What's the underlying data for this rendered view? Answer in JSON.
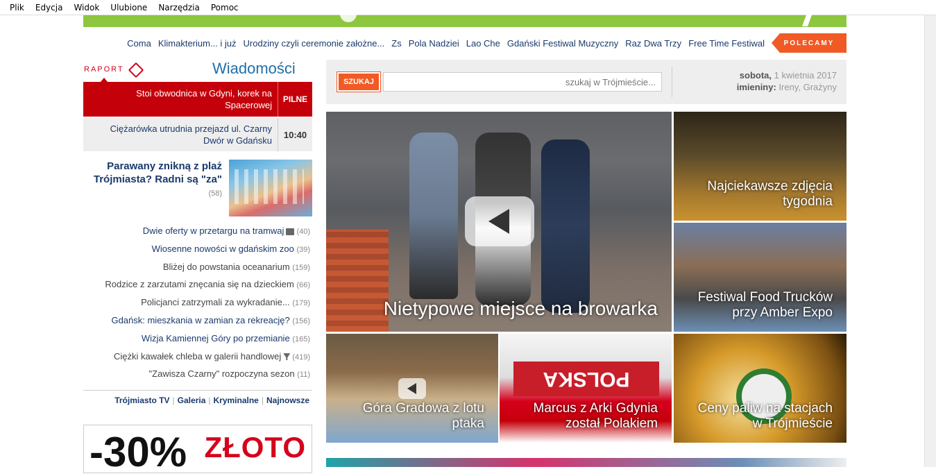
{
  "menu": [
    "Plik",
    "Edycja",
    "Widok",
    "Ulubione",
    "Narzędzia",
    "Pomoc"
  ],
  "recommend": {
    "badge": "POLECAMY",
    "links": [
      "Free Time Festiwal",
      "Raz Dwa Trzy",
      "Gdański Festiwal Muzyczny",
      "Lao Che",
      "Pola Nadziei",
      "Zs",
      "Urodziny czyli ceremonie założne...",
      "Klimakterium... i już",
      "Coma"
    ]
  },
  "news": {
    "title": "Wiadomości",
    "raport": "RAPORT",
    "urgent": {
      "label": "PILNE",
      "text": "Stoi obwodnica w Gdyni, korek na Spacerowej"
    },
    "latest": {
      "time": "10:40",
      "text": "Ciężarówka utrudnia przejazd ul. Czarny Dwór w Gdańsku"
    },
    "feature": {
      "title": "Parawany znikną z plaż Trójmiasta? Radni są \"za\"",
      "count": "(58)"
    },
    "items": [
      {
        "text": "Dwie oferty w przetargu na tramwaj",
        "count": "(40)",
        "icon": "video"
      },
      {
        "text": "Wiosenne nowości w gdańskim zoo",
        "count": "(39)"
      },
      {
        "text": "Bliżej do powstania oceanarium",
        "count": "(159)"
      },
      {
        "text": "Rodzice z zarzutami znęcania się na dzieckiem",
        "count": "(66)"
      },
      {
        "text": "Policjanci zatrzymali za wykradanie...",
        "count": "(179)"
      },
      {
        "text": "Gdańsk: mieszkania w zamian za rekreację?",
        "count": "(156)"
      },
      {
        "text": "Wizja Kamiennej Góry po przemianie",
        "count": "(165)"
      },
      {
        "text": "Ciężki kawałek chleba w galerii handlowej",
        "count": "(419)",
        "icon": "filter"
      },
      {
        "text": "\"Zawisza Czarny\" rozpoczyna sezon",
        "count": "(11)"
      }
    ],
    "bottom_links": [
      "Najnowsze",
      "Kryminalne",
      "Galeria",
      "Trójmiasto TV"
    ]
  },
  "ad": {
    "brand": "ZŁOTO",
    "discount": "-30%"
  },
  "search": {
    "date_label": "sobota,",
    "date_value": "1 kwietnia 2017",
    "names_label": "imieniny:",
    "names_value": "Ireny, Grażyny",
    "placeholder": "szukaj w Trójmieście...",
    "button": "SZUKAJ"
  },
  "tiles": {
    "main": "Nietypowe miejsce na browarka",
    "t1": "Najciekawsze zdjęcia tygodnia",
    "t2": "Festiwal Food Trucków przy Amber Expo",
    "t3": "Góra Gradowa z lotu ptaka",
    "t4": "Marcus z Arki Gdynia został Polakiem",
    "t4_scarf": "POLSKA",
    "t5": "Ceny paliw na stacjach w Trójmieście"
  },
  "colors": {
    "accent": "#f15a24",
    "urgent": "#c4000a",
    "link": "#1a3a6c",
    "green": "#8dc63f"
  }
}
